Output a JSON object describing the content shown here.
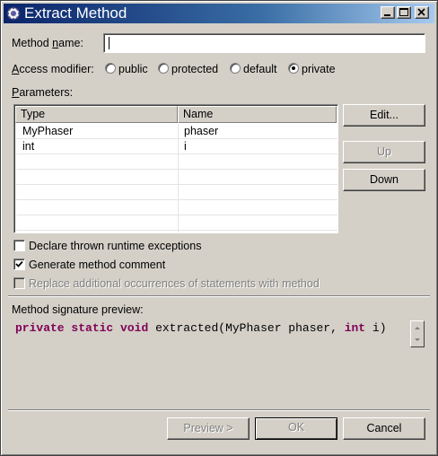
{
  "window": {
    "title": "Extract Method",
    "icon": "gear-icon"
  },
  "method_name": {
    "label": "Method name:",
    "value": ""
  },
  "access_modifier": {
    "label": "Access modifier:",
    "options": [
      "public",
      "protected",
      "default",
      "private"
    ],
    "selected": "private"
  },
  "parameters": {
    "label": "Parameters:",
    "columns": [
      "Type",
      "Name"
    ],
    "rows": [
      {
        "type": "MyPhaser",
        "name": "phaser"
      },
      {
        "type": "int",
        "name": "i"
      }
    ],
    "buttons": {
      "edit": "Edit...",
      "up": "Up",
      "down": "Down"
    }
  },
  "options": {
    "declare_exceptions": {
      "label": "Declare thrown runtime exceptions",
      "checked": false
    },
    "generate_comment": {
      "label": "Generate method comment",
      "checked": true
    },
    "replace_occurrences": {
      "label": "Replace additional occurrences of statements with method",
      "checked": false,
      "enabled": false
    }
  },
  "signature_preview": {
    "label": "Method signature preview:",
    "tokens": [
      {
        "text": "private",
        "kind": "keyword"
      },
      {
        "text": " ",
        "kind": "plain"
      },
      {
        "text": "static",
        "kind": "keyword"
      },
      {
        "text": " ",
        "kind": "plain"
      },
      {
        "text": "void",
        "kind": "keyword"
      },
      {
        "text": " extracted(MyPhaser phaser, ",
        "kind": "plain"
      },
      {
        "text": "int",
        "kind": "keyword"
      },
      {
        "text": " i)",
        "kind": "plain"
      }
    ]
  },
  "footer": {
    "preview": "Preview >",
    "ok": "OK",
    "cancel": "Cancel"
  },
  "colors": {
    "keyword": "#7f0055",
    "dialog_bg": "#d4d0c8",
    "title_start": "#0a246a",
    "title_end": "#a6caf0"
  }
}
